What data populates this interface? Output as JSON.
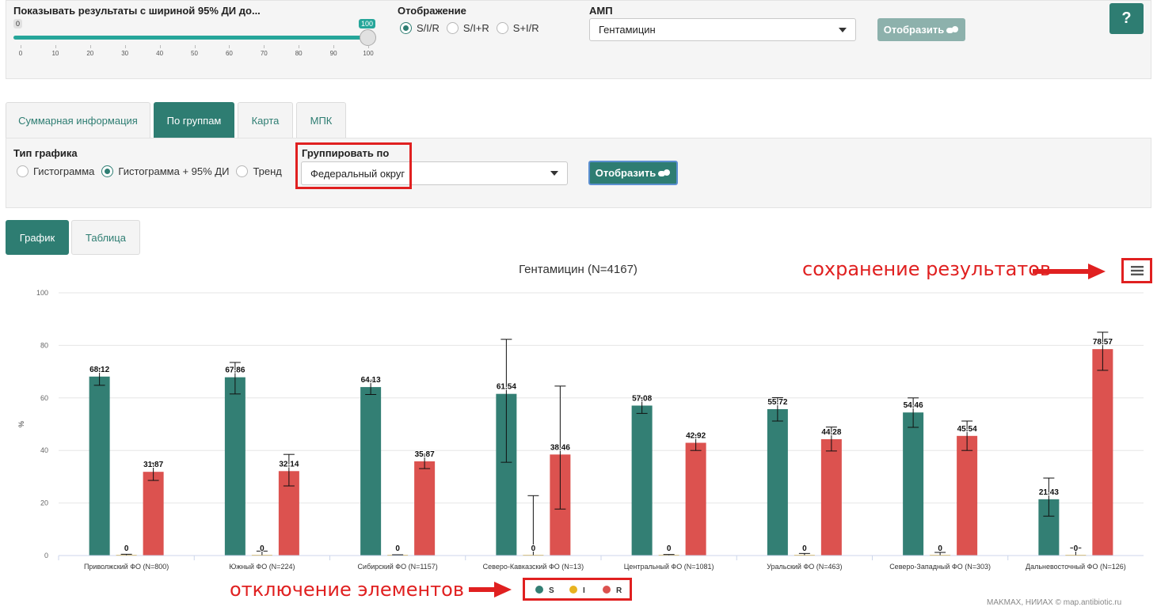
{
  "filters": {
    "ci_label": "Показывать результаты с шириной 95% ДИ до...",
    "slider": {
      "min": 0,
      "max": 100,
      "value": 100,
      "ticks": [
        "0",
        "10",
        "20",
        "30",
        "40",
        "50",
        "60",
        "70",
        "80",
        "90",
        "100"
      ],
      "min_badge": "0",
      "value_badge": "100"
    },
    "display_label": "Отображение",
    "display_options": [
      "S/I/R",
      "S/I+R",
      "S+I/R"
    ],
    "display_selected": "S/I/R",
    "amp_label": "АМП",
    "amp_value": "Гентамицин",
    "show_button": "Отобразить",
    "help_button": "?"
  },
  "tabs": [
    "Суммарная информация",
    "По группам",
    "Карта",
    "МПК"
  ],
  "active_tab": "По группам",
  "chart_options": {
    "type_label": "Тип графика",
    "type_options": [
      "Гистограмма",
      "Гистограмма + 95% ДИ",
      "Тренд"
    ],
    "type_selected": "Гистограмма + 95% ДИ",
    "group_label": "Группировать по",
    "group_value": "Федеральный округ",
    "show_button": "Отобразить"
  },
  "view_tabs": [
    "График",
    "Таблица"
  ],
  "active_view": "График",
  "annotations": {
    "save": "сохранение результатов",
    "toggle": "отключение элементов"
  },
  "footer_text": "MAKMAX, НИИАХ © map.antibiotic.ru",
  "colors": {
    "S": "#337f74",
    "I": "#e8b320",
    "R": "#dc524f",
    "accent": "#2e7d72",
    "annotation": "#e02020"
  },
  "chart_data": {
    "type": "bar",
    "title": "Гентамицин (N=4167)",
    "ylabel": "%",
    "xlabel": "",
    "ylim": [
      0,
      100
    ],
    "yticks": [
      0,
      20,
      40,
      60,
      80,
      100
    ],
    "grid": true,
    "legend_position": "bottom-center",
    "categories": [
      "Приволжский ФО (N=800)",
      "Южный ФО (N=224)",
      "Сибирский ФО (N=1157)",
      "Северо-Кавказский ФО (N=13)",
      "Центральный ФО (N=1081)",
      "Уральский ФО (N=463)",
      "Северо-Западный ФО (N=303)",
      "Дальневосточный ФО (N=126)"
    ],
    "series": [
      {
        "name": "S",
        "values": [
          68.12,
          67.86,
          64.13,
          61.54,
          57.08,
          55.72,
          54.46,
          21.43
        ],
        "ci_low": [
          64.8,
          61.5,
          61.3,
          35.5,
          54.1,
          51.2,
          48.8,
          15.0
        ],
        "ci_high": [
          71.3,
          73.5,
          66.8,
          82.3,
          60.0,
          60.1,
          60.0,
          29.5
        ]
      },
      {
        "name": "I",
        "values": [
          0,
          0,
          0,
          0,
          0,
          0,
          0,
          0
        ],
        "ci_low": [
          0,
          0,
          0,
          0,
          0,
          0,
          0,
          0
        ],
        "ci_high": [
          0.5,
          1.7,
          0.3,
          22.8,
          0.4,
          0.8,
          1.2,
          2.9
        ]
      },
      {
        "name": "R",
        "values": [
          31.87,
          32.14,
          35.87,
          38.46,
          42.92,
          44.28,
          45.54,
          78.57
        ],
        "ci_low": [
          28.6,
          26.5,
          33.1,
          17.7,
          40.0,
          39.8,
          40.0,
          70.5
        ],
        "ci_high": [
          35.2,
          38.5,
          38.6,
          64.5,
          45.9,
          48.9,
          51.2,
          85.0
        ]
      }
    ],
    "data_labels": [
      [
        "68.12",
        "67.86",
        "64.13",
        "61.54",
        "57.08",
        "55.72",
        "54.46",
        "21.43"
      ],
      [
        "0",
        "0",
        "0",
        "0",
        "0",
        "0",
        "0",
        "0"
      ],
      [
        "31.87",
        "32.14",
        "35.87",
        "38.46",
        "42.92",
        "44.28",
        "45.54",
        "78.57"
      ]
    ]
  }
}
